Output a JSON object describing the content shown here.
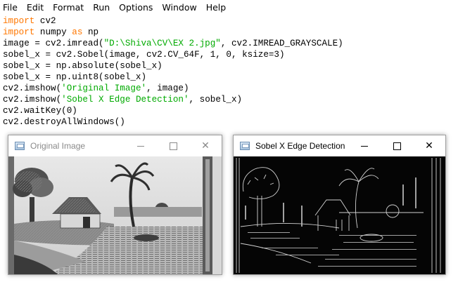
{
  "menu": [
    "File",
    "Edit",
    "Format",
    "Run",
    "Options",
    "Window",
    "Help"
  ],
  "code_lines": [
    [
      {
        "t": "import",
        "c": "kw"
      },
      {
        "t": " cv2",
        "c": ""
      }
    ],
    [
      {
        "t": "import",
        "c": "kw"
      },
      {
        "t": " numpy ",
        "c": ""
      },
      {
        "t": "as",
        "c": "kw"
      },
      {
        "t": " np",
        "c": ""
      }
    ],
    [
      {
        "t": "image = cv2.imread(",
        "c": ""
      },
      {
        "t": "\"D:\\Shiva\\CV\\EX 2.jpg\"",
        "c": "str"
      },
      {
        "t": ", cv2.IMREAD_GRAYSCALE)",
        "c": ""
      }
    ],
    [
      {
        "t": "sobel_x = cv2.Sobel(image, cv2.CV_64F, 1, 0, ksize=3)",
        "c": ""
      }
    ],
    [
      {
        "t": "sobel_x = np.absolute(sobel_x)",
        "c": ""
      }
    ],
    [
      {
        "t": "sobel_x = np.uint8(sobel_x)",
        "c": ""
      }
    ],
    [
      {
        "t": "cv2.imshow(",
        "c": ""
      },
      {
        "t": "'Original Image'",
        "c": "str"
      },
      {
        "t": ", image)",
        "c": ""
      }
    ],
    [
      {
        "t": "cv2.imshow(",
        "c": ""
      },
      {
        "t": "'Sobel X Edge Detection'",
        "c": "str"
      },
      {
        "t": ", sobel_x)",
        "c": ""
      }
    ],
    [
      {
        "t": "cv2.waitKey(0)",
        "c": ""
      }
    ],
    [
      {
        "t": "cv2.destroyAllWindows()",
        "c": ""
      }
    ]
  ],
  "windows": {
    "original": {
      "title": "Original Image",
      "active": false
    },
    "sobel": {
      "title": "Sobel X Edge Detection",
      "active": true
    }
  },
  "colors": {
    "keyword": "#ff7700",
    "string": "#00aa00",
    "inactive_title": "#8a8a8a"
  }
}
